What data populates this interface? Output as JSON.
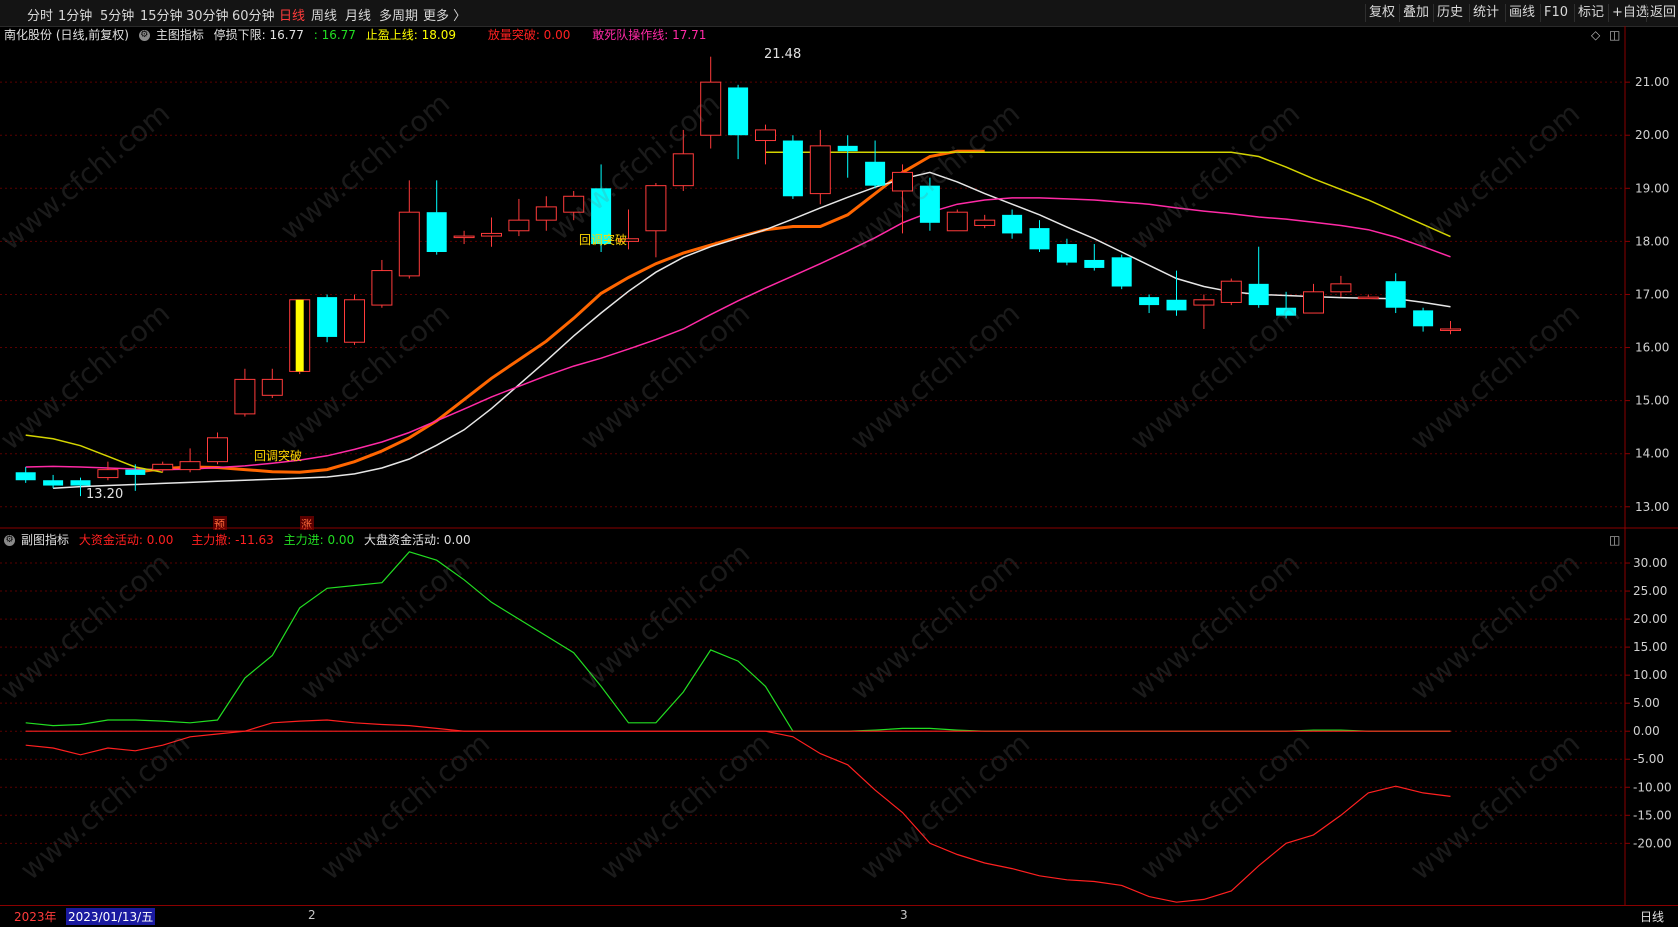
{
  "toolbar": {
    "periods": [
      "分时",
      "1分钟",
      "5分钟",
      "15分钟",
      "30分钟",
      "60分钟",
      "日线",
      "周线",
      "月线",
      "多周期",
      "更多 〉"
    ],
    "active_period": "日线",
    "right_buttons": [
      "复权",
      "叠加",
      "历史",
      "统计",
      "画线",
      "F10",
      "标记",
      "+自选",
      "返回"
    ]
  },
  "main_info": {
    "stock": "南化股份 (日线,前复权)",
    "indicator": "主图指标",
    "stop_loss_label": "停损下限: 16.77",
    "stop_loss_value2": ": 16.77",
    "take_profit": "止盈上线: 18.09",
    "volume_breakout": "放量突破: 0.00",
    "dare_die_line": "敢死队操作线: 17.71"
  },
  "sub_info": {
    "indicator": "副图指标",
    "big_money": "大资金活动: 0.00",
    "main_out": "主力撤: -11.63",
    "main_in": "主力进: 0.00",
    "market_money": "大盘资金活动: 0.00"
  },
  "bottom": {
    "year": "2023年",
    "date": "2023/01/13/五",
    "month2": "2",
    "month3": "3",
    "period": "日线"
  },
  "annotations": {
    "high_label": "21.48",
    "low_label": "13.20",
    "breakout1": "回调突破",
    "breakout2": "回调突破",
    "marker1": "预",
    "marker2": "涨"
  },
  "watermark": "www.cfchi.com",
  "colors": {
    "up": "#ff3b3b",
    "down": "#00ffff",
    "ma_orange": "#ff6600",
    "ma_white": "#e6e6e6",
    "ma_pink": "#ff2aa6",
    "ma_yellow": "#d4d400",
    "green_line": "#22dd22",
    "red_line": "#ff2020"
  },
  "chart_data": [
    {
      "type": "candlestick",
      "ylim": [
        12.6,
        21.7
      ],
      "y_ticks": [
        13.0,
        14.0,
        15.0,
        16.0,
        17.0,
        18.0,
        19.0,
        20.0,
        21.0
      ],
      "y_tick_labels": [
        "13.00",
        "14.00",
        "15.00",
        "16.00",
        "17.00",
        "18.00",
        "19.00",
        "20.00",
        "21.00"
      ],
      "candles": [
        [
          13.65,
          13.5,
          13.75,
          13.45
        ],
        [
          13.5,
          13.4,
          13.6,
          13.35
        ],
        [
          13.5,
          13.4,
          13.55,
          13.2
        ],
        [
          13.55,
          13.7,
          13.85,
          13.5
        ],
        [
          13.7,
          13.6,
          13.8,
          13.3
        ],
        [
          13.7,
          13.8,
          13.85,
          13.65
        ],
        [
          13.7,
          13.85,
          14.1,
          13.65
        ],
        [
          13.85,
          14.3,
          14.4,
          13.8
        ],
        [
          14.75,
          15.4,
          15.6,
          14.7
        ],
        [
          15.1,
          15.4,
          15.6,
          15.05
        ],
        [
          15.55,
          16.9,
          16.9,
          15.5
        ],
        [
          16.95,
          16.2,
          17.0,
          16.1
        ],
        [
          16.1,
          16.9,
          17.0,
          16.05
        ],
        [
          16.8,
          17.45,
          17.65,
          16.75
        ],
        [
          17.35,
          18.55,
          19.15,
          17.3
        ],
        [
          18.55,
          17.8,
          19.15,
          17.75
        ],
        [
          18.1,
          18.1,
          18.2,
          17.95
        ],
        [
          18.1,
          18.15,
          18.45,
          17.9
        ],
        [
          18.2,
          18.4,
          18.8,
          18.1
        ],
        [
          18.4,
          18.65,
          18.85,
          18.2
        ],
        [
          18.55,
          18.85,
          18.95,
          18.4
        ],
        [
          19.0,
          17.95,
          19.45,
          17.8
        ],
        [
          18.0,
          18.05,
          18.6,
          17.85
        ],
        [
          18.2,
          19.05,
          19.1,
          17.7
        ],
        [
          19.05,
          19.65,
          20.1,
          18.95
        ],
        [
          20.0,
          21.0,
          21.48,
          19.75
        ],
        [
          20.9,
          20.0,
          20.95,
          19.55
        ],
        [
          19.9,
          20.1,
          20.2,
          19.45
        ],
        [
          19.9,
          18.85,
          20.0,
          18.8
        ],
        [
          18.9,
          19.8,
          20.1,
          18.7
        ],
        [
          19.8,
          19.7,
          20.0,
          19.2
        ],
        [
          19.5,
          19.05,
          19.9,
          19.0
        ],
        [
          18.95,
          19.3,
          19.45,
          18.15
        ],
        [
          19.05,
          18.35,
          19.2,
          18.2
        ],
        [
          18.2,
          18.55,
          18.6,
          18.2
        ],
        [
          18.3,
          18.4,
          18.5,
          18.25
        ],
        [
          18.5,
          18.15,
          18.6,
          18.05
        ],
        [
          18.25,
          17.85,
          18.4,
          17.8
        ],
        [
          17.95,
          17.6,
          18.05,
          17.55
        ],
        [
          17.65,
          17.5,
          17.95,
          17.45
        ],
        [
          17.7,
          17.15,
          17.75,
          17.1
        ],
        [
          16.95,
          16.8,
          17.0,
          16.65
        ],
        [
          16.9,
          16.7,
          17.45,
          16.6
        ],
        [
          16.8,
          16.9,
          17.0,
          16.35
        ],
        [
          16.85,
          17.25,
          17.3,
          16.8
        ],
        [
          17.2,
          16.8,
          17.9,
          16.75
        ],
        [
          16.75,
          16.6,
          17.05,
          16.55
        ],
        [
          16.65,
          17.05,
          17.2,
          16.65
        ],
        [
          17.05,
          17.2,
          17.35,
          16.95
        ],
        [
          16.95,
          16.95,
          17.0,
          16.95
        ],
        [
          17.25,
          16.75,
          17.4,
          16.65
        ],
        [
          16.7,
          16.4,
          16.75,
          16.3
        ],
        [
          16.35,
          16.35,
          16.5,
          16.25
        ]
      ],
      "series": [
        {
          "values": [
            13.65,
            13.72,
            13.75,
            13.74,
            13.7,
            13.66,
            13.65,
            13.7,
            13.85,
            14.05,
            14.3,
            14.62,
            15.02,
            15.42,
            15.77,
            16.12,
            16.55,
            17.02,
            17.32,
            17.58,
            17.78,
            17.93,
            18.08,
            18.22,
            18.28,
            18.28,
            18.5,
            18.9,
            19.3,
            19.6,
            19.7,
            19.7
          ]
        },
        {
          "values": [
            13.35,
            13.38,
            13.4,
            13.42,
            13.44,
            13.46,
            13.48,
            13.5,
            13.52,
            13.54,
            13.56,
            13.62,
            13.73,
            13.9,
            14.16,
            14.45,
            14.85,
            15.3,
            15.75,
            16.22,
            16.65,
            17.06,
            17.42,
            17.7,
            17.9,
            18.06,
            18.22,
            18.42,
            18.63,
            18.83,
            19.02,
            19.18,
            19.3,
            19.12,
            18.9,
            18.7,
            18.5,
            18.27,
            18.05,
            17.8,
            17.55,
            17.3,
            17.15,
            17.05,
            17.0,
            16.98,
            16.96,
            16.94,
            16.93,
            16.92,
            16.85,
            16.77
          ]
        },
        {
          "values": [
            13.75,
            13.76,
            13.75,
            13.73,
            13.71,
            13.7,
            13.71,
            13.74,
            13.77,
            13.82,
            13.88,
            13.96,
            14.08,
            14.22,
            14.4,
            14.62,
            14.84,
            15.07,
            15.27,
            15.47,
            15.65,
            15.8,
            15.97,
            16.15,
            16.35,
            16.62,
            16.88,
            17.12,
            17.35,
            17.58,
            17.82,
            18.07,
            18.35,
            18.55,
            18.7,
            18.78,
            18.82,
            18.82,
            18.8,
            18.78,
            18.74,
            18.7,
            18.63,
            18.57,
            18.52,
            18.46,
            18.42,
            18.36,
            18.3,
            18.22,
            18.08,
            17.9,
            17.71
          ]
        },
        {
          "values": [
            14.35,
            14.28,
            14.15,
            13.95,
            13.75,
            13.65
          ]
        },
        {
          "values": [
            19.68,
            19.68,
            19.68,
            19.68,
            19.68,
            19.68,
            19.68,
            19.68,
            19.68,
            19.68,
            19.68,
            19.68,
            19.68,
            19.68,
            19.68,
            19.68,
            19.68,
            19.68,
            19.6,
            19.4,
            19.18,
            18.98,
            18.78,
            18.55,
            18.32,
            18.09
          ]
        }
      ]
    },
    {
      "type": "line",
      "ylim": [
        -31,
        35
      ],
      "y_ticks": [
        30,
        25,
        20,
        15,
        10,
        5,
        0,
        -5,
        -10,
        -15,
        -20
      ],
      "y_tick_labels": [
        "30.00",
        "25.00",
        "20.00",
        "15.00",
        "10.00",
        "5.00",
        "0.00",
        "-5.00",
        "-10.00",
        "-15.00",
        "-20.00"
      ],
      "series": [
        {
          "values": [
            1.5,
            1.0,
            1.2,
            2.0,
            2.0,
            1.8,
            1.5,
            2.0,
            9.5,
            13.5,
            22.0,
            25.5,
            26.0,
            26.5,
            32.0,
            30.5,
            27.0,
            23.0,
            20.0,
            17.0,
            14.0,
            8.0,
            1.5,
            1.5,
            7.0,
            14.5,
            12.5,
            8.0,
            0.0,
            0.0,
            0.0,
            0.2,
            0.5,
            0.5,
            0.2,
            0.0,
            0.0,
            0.0,
            0.0,
            0.0,
            0.0,
            0.0,
            0.0,
            0.0,
            0.0,
            0.0,
            0.0,
            0.2,
            0.2,
            0.0,
            0.0,
            0.0,
            0.0
          ]
        },
        {
          "values": [
            0.0,
            0.0,
            0.0,
            0.0,
            0.0,
            0.0,
            0.0,
            0.0,
            0.0,
            1.5,
            1.8,
            2.0,
            1.5,
            1.2,
            1.0,
            0.5,
            0.0,
            0.0,
            0.0,
            0.0,
            0.0,
            0.0,
            0.0,
            0.0,
            0.0,
            0.0,
            0.0,
            0.0,
            0.0,
            0.0,
            0.0,
            0.0,
            0.0,
            0.0,
            0.0,
            0.0,
            0.0,
            0.0,
            0.0,
            0.0,
            0.0,
            0.0,
            0.0,
            0.0,
            0.0,
            0.0,
            0.0,
            0.0,
            0.0,
            0.0,
            0.0,
            0.0,
            0.0
          ]
        },
        {
          "values": [
            -2.5,
            -3.0,
            -4.2,
            -3.0,
            -3.5,
            -2.5,
            -1.0,
            -0.5,
            0.0,
            0.0,
            0.0,
            0.0,
            0.0,
            0.0,
            0.0,
            0.0,
            0.0,
            0.0,
            0.0,
            0.0,
            0.0,
            0.0,
            0.0,
            0.0,
            0.0,
            0.0,
            0.0,
            0.0,
            -1.0,
            -4.0,
            -6.0,
            -10.5,
            -14.5,
            -20.0,
            -22.0,
            -23.5,
            -24.5,
            -25.8,
            -26.5,
            -26.8,
            -27.5,
            -29.5,
            -30.5,
            -30.0,
            -28.5,
            -24.0,
            -20.0,
            -18.5,
            -15.0,
            -11.0,
            -9.8,
            -11.0,
            -11.63
          ]
        }
      ]
    }
  ]
}
